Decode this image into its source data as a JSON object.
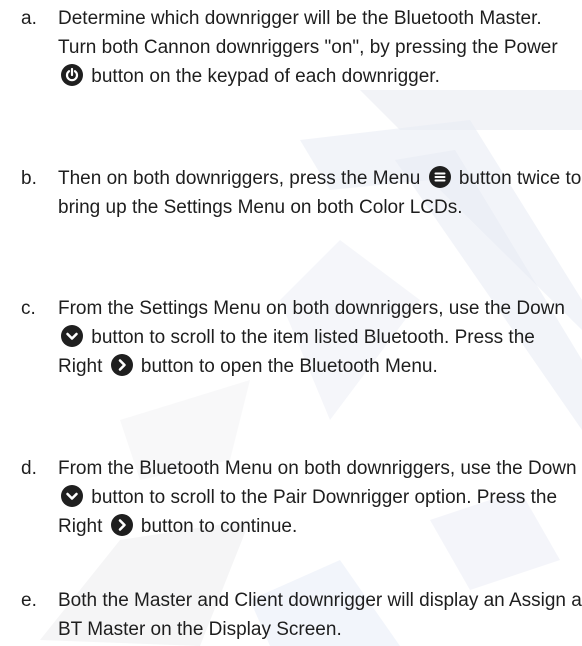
{
  "steps": [
    {
      "letter": "a.",
      "t1": "Determine which downrigger will be the Bluetooth Master. Turn both Cannon downriggers \"on\", by pressing the Power",
      "t2": "button on the keypad of each downrigger."
    },
    {
      "letter": "b.",
      "t1": "Then on both downriggers, press the Menu",
      "t2": "button twice to bring up the Settings Menu on both Color LCDs."
    },
    {
      "letter": "c.",
      "t1": "From the Settings Menu on both downriggers, use the Down",
      "t2": "button to scroll to the item listed Bluetooth. Press the Right",
      "t3": "button to open the Bluetooth Menu."
    },
    {
      "letter": "d.",
      "t1": "From the Bluetooth Menu on both downriggers, use the Down",
      "t2": "button to scroll to the Pair Downrigger option. Press the Right",
      "t3": "button to continue."
    },
    {
      "letter": "e.",
      "t1": "Both the Master and Client downrigger will display an Assign a BT Master on the Display Screen."
    }
  ],
  "icons": {
    "power": "power-icon",
    "menu": "menu-icon",
    "down": "chevron-down-icon",
    "right": "chevron-right-icon"
  },
  "colors": {
    "text": "#1e1e1e",
    "icon_bg": "#1f1f1f",
    "watermark_gray": "#e6e6e9",
    "watermark_blue": "#e3e8f6"
  }
}
